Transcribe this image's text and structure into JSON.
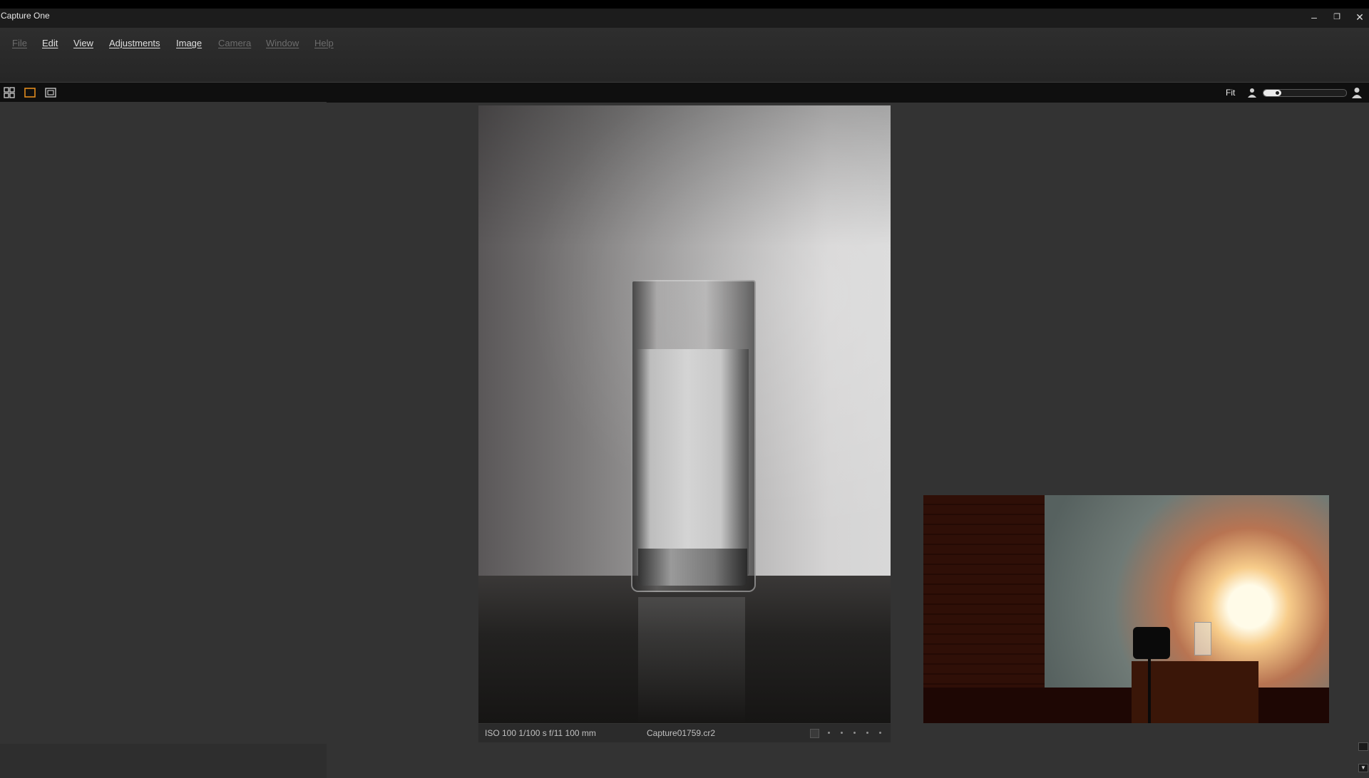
{
  "window": {
    "title": "Capture One",
    "controls": {
      "minimize": "–",
      "restore": "❐",
      "close": "✕"
    }
  },
  "menu": [
    {
      "label": "File",
      "enabled": false
    },
    {
      "label": "Edit",
      "enabled": true
    },
    {
      "label": "View",
      "enabled": true
    },
    {
      "label": "Adjustments",
      "enabled": true
    },
    {
      "label": "Image",
      "enabled": true
    },
    {
      "label": "Camera",
      "enabled": false
    },
    {
      "label": "Window",
      "enabled": false
    },
    {
      "label": "Help",
      "enabled": false
    }
  ],
  "toolbar": {
    "view_modes": [
      "grid-view-icon",
      "single-view-icon",
      "multi-view-icon"
    ],
    "active_view": "single-view-icon",
    "zoom_label": "Fit",
    "zoom_slider_value": 0.15,
    "accent": "#e08a1e"
  },
  "viewer": {
    "exif": "ISO 100  1/100 s  f/11  100 mm",
    "filename": "Capture01759.cr2",
    "rating_max": 5
  }
}
